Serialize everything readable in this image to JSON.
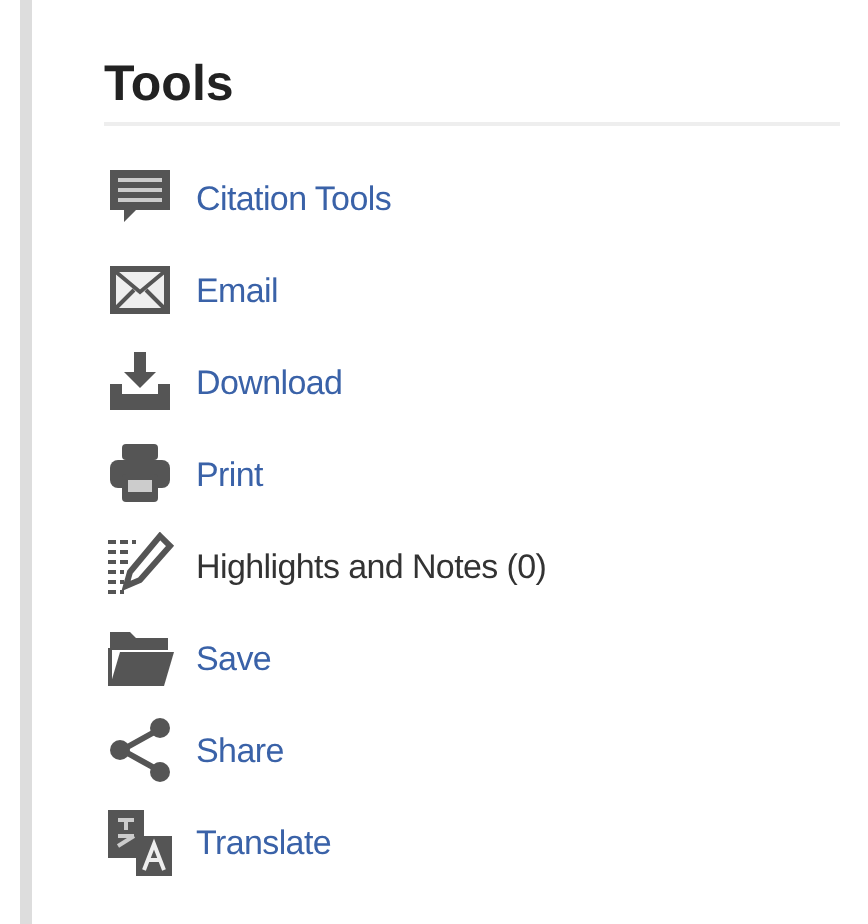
{
  "panel": {
    "title": "Tools",
    "items": [
      {
        "kind": "comment",
        "label": "Citation Tools",
        "link": true
      },
      {
        "kind": "mail",
        "label": "Email",
        "link": true
      },
      {
        "kind": "download",
        "label": "Download",
        "link": true
      },
      {
        "kind": "print",
        "label": "Print",
        "link": true
      },
      {
        "kind": "notes",
        "label": "Highlights and Notes (0)",
        "link": false
      },
      {
        "kind": "folder",
        "label": "Save",
        "link": true
      },
      {
        "kind": "share",
        "label": "Share",
        "link": true
      },
      {
        "kind": "translate",
        "label": "Translate",
        "link": true
      }
    ]
  }
}
